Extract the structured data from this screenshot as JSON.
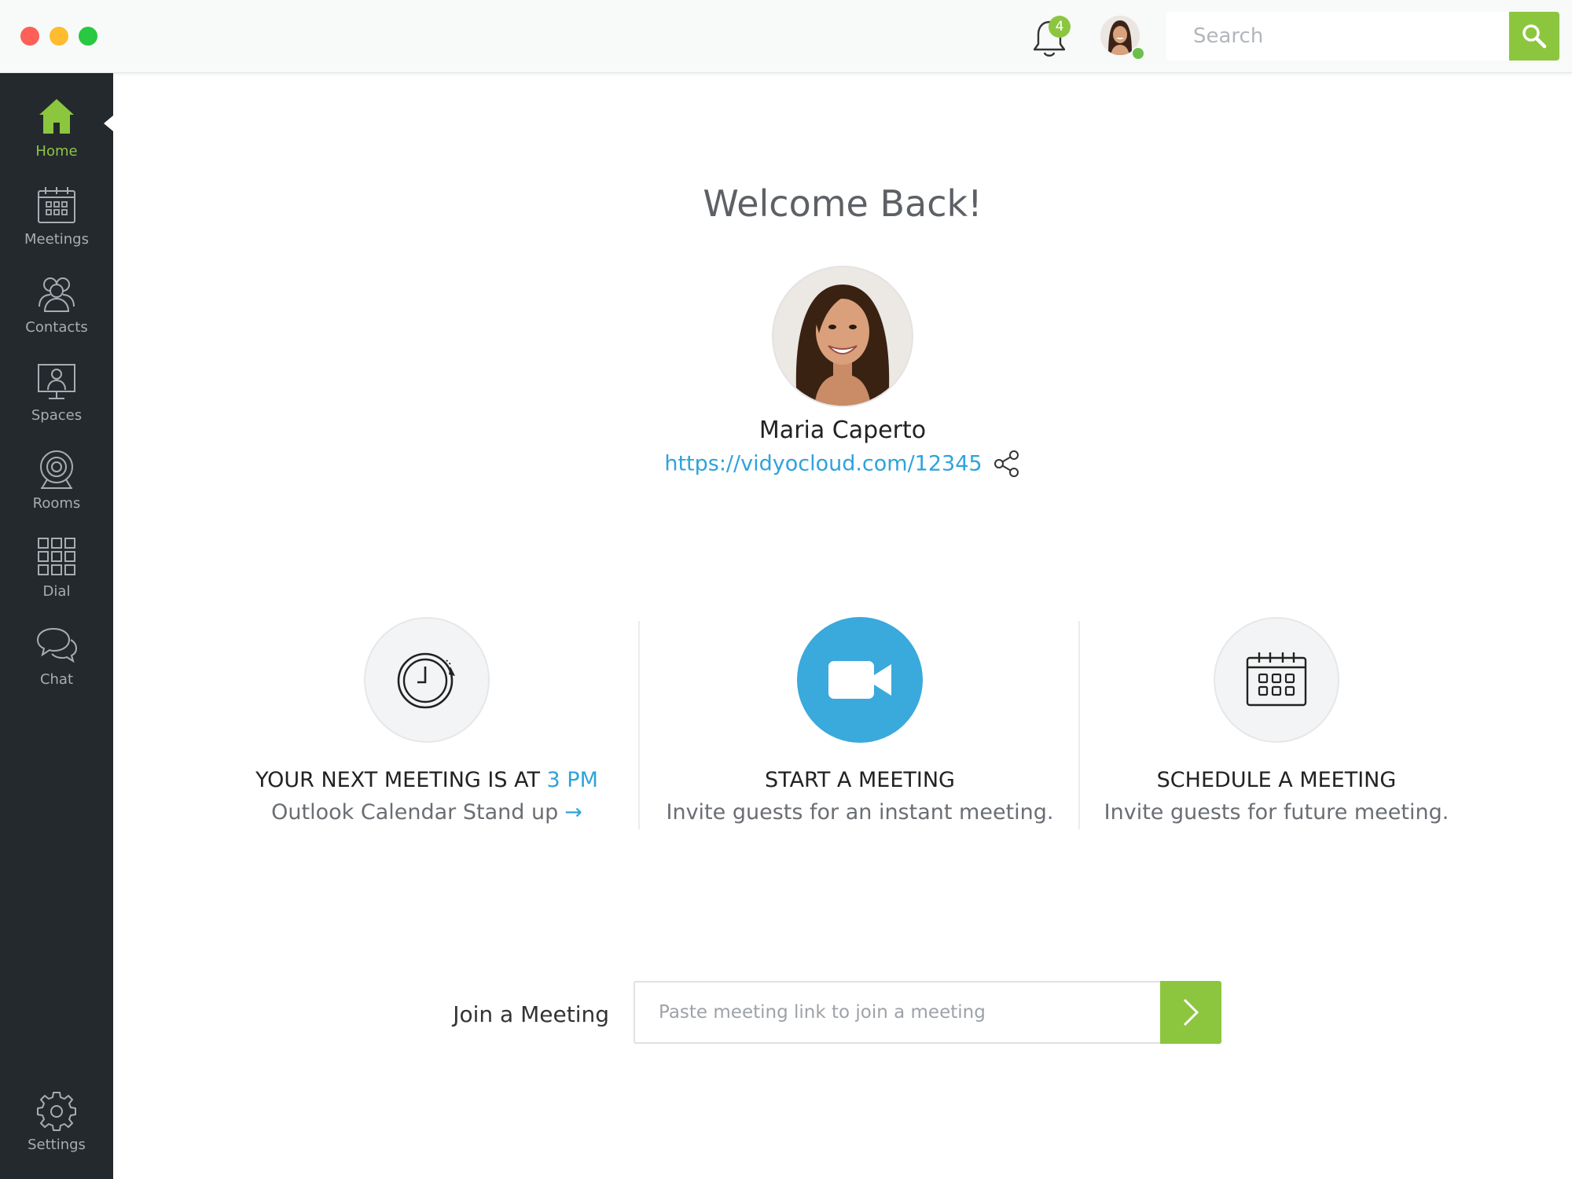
{
  "titlebar": {
    "notification_count": "4",
    "search": {
      "placeholder": "Search",
      "value": ""
    }
  },
  "sidebar": {
    "items": [
      {
        "label": "Home",
        "icon": "home-icon",
        "active": true
      },
      {
        "label": "Meetings",
        "icon": "calendar-icon",
        "active": false
      },
      {
        "label": "Contacts",
        "icon": "people-icon",
        "active": false
      },
      {
        "label": "Spaces",
        "icon": "monitor-user-icon",
        "active": false
      },
      {
        "label": "Rooms",
        "icon": "webcam-icon",
        "active": false
      },
      {
        "label": "Dial",
        "icon": "dialpad-icon",
        "active": false
      },
      {
        "label": "Chat",
        "icon": "chat-bubbles-icon",
        "active": false
      }
    ],
    "settings": {
      "label": "Settings",
      "icon": "gear-icon"
    }
  },
  "main": {
    "welcome": "Welcome Back!",
    "profile": {
      "name": "Maria Caperto",
      "link": "https://vidyocloud.com/12345"
    },
    "cards": [
      {
        "title_prefix": "YOUR NEXT MEETING IS AT ",
        "title_accent": "3 PM",
        "subtitle": "Outlook Calendar Stand up",
        "icon": "clock-icon"
      },
      {
        "title": "START A MEETING",
        "subtitle": "Invite guests for an instant meeting.",
        "icon": "video-camera-icon"
      },
      {
        "title": "SCHEDULE A MEETING",
        "subtitle": "Invite guests for future meeting.",
        "icon": "calendar-icon"
      }
    ],
    "join": {
      "label": "Join a Meeting",
      "placeholder": "Paste meeting link to join a meeting",
      "value": ""
    }
  },
  "colors": {
    "accent_green": "#8cc63f",
    "accent_blue": "#2ea3dc",
    "sidebar_bg": "#24292d",
    "sidebar_text": "#a8adb2"
  }
}
